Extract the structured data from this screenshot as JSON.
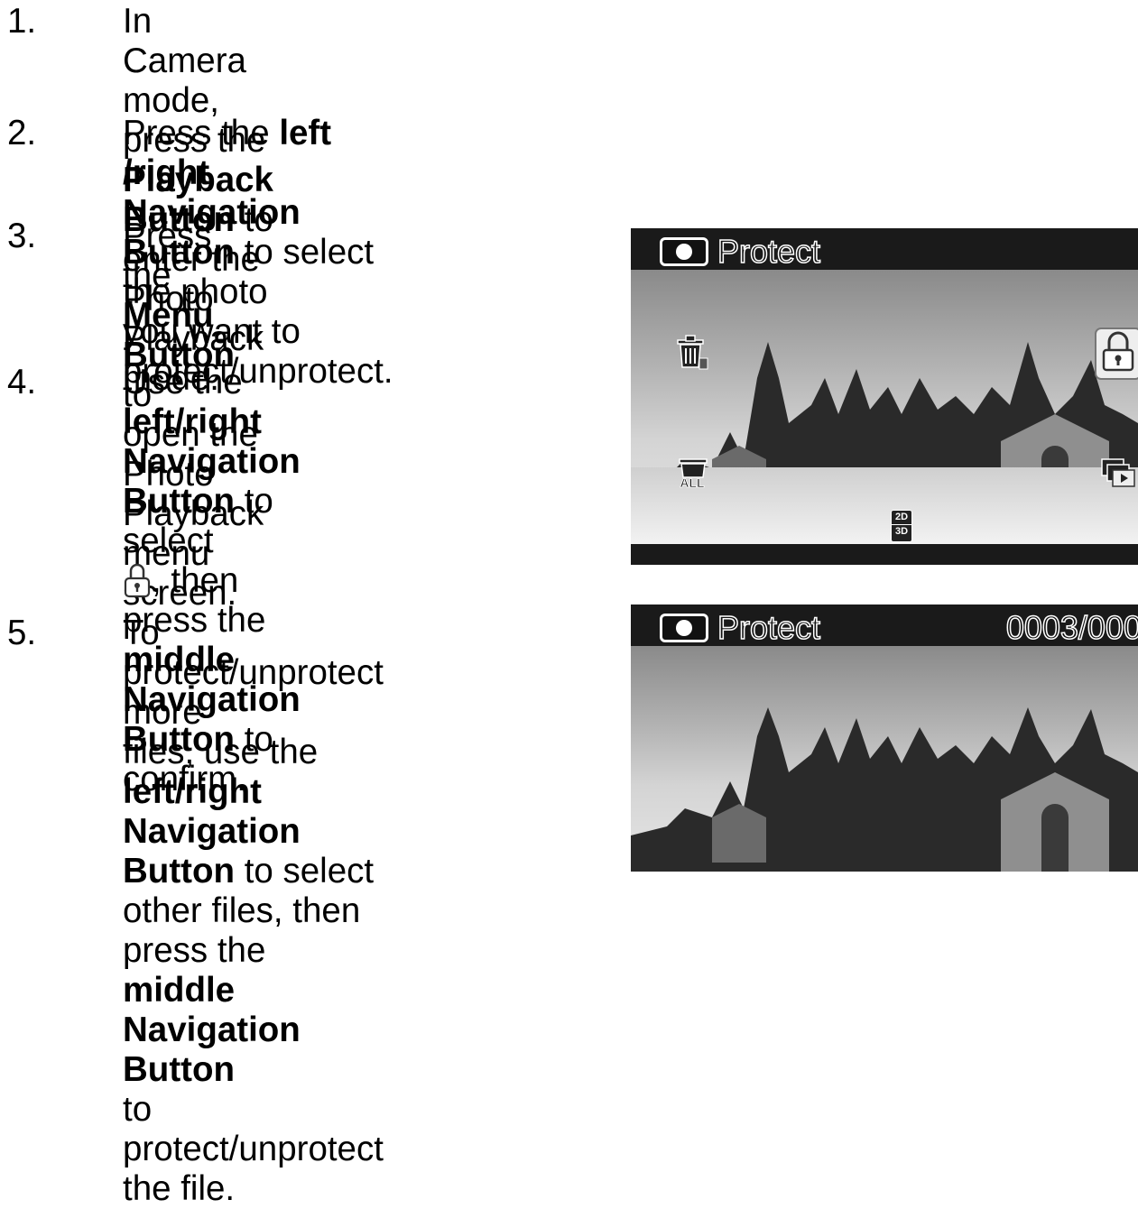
{
  "steps": [
    {
      "number": "1.",
      "lines": [
        {
          "segments": [
            {
              "text": "In Camera mode, press the ",
              "bold": false
            },
            {
              "text": "Playback Button",
              "bold": true
            },
            {
              "text": " to enter the",
              "bold": false
            }
          ]
        },
        {
          "segments": [
            {
              "text": "Photo Playback mode.",
              "bold": false
            }
          ]
        }
      ]
    },
    {
      "number": "2.",
      "lines": [
        {
          "segments": [
            {
              "text": "Press the ",
              "bold": false
            },
            {
              "text": "left /right Navigation Button",
              "bold": true
            },
            {
              "text": " to select the photo",
              "bold": false
            }
          ]
        },
        {
          "segments": [
            {
              "text": "you want to protect/unprotect.",
              "bold": false
            }
          ]
        }
      ]
    },
    {
      "number": "3.",
      "lines": [
        {
          "segments": [
            {
              "text": "Press the ",
              "bold": false
            },
            {
              "text": "Menu Button",
              "bold": true
            },
            {
              "text": " to",
              "bold": false
            }
          ]
        },
        {
          "segments": [
            {
              "text": "open the Photo Playback",
              "bold": false
            }
          ]
        },
        {
          "segments": [
            {
              "text": "menu screen.",
              "bold": false
            }
          ]
        }
      ]
    },
    {
      "number": "4.",
      "lines": [
        {
          "segments": [
            {
              "text": "Use the ",
              "bold": false
            },
            {
              "text": "left/right",
              "bold": true
            }
          ]
        },
        {
          "segments": [
            {
              "text": "Navigation Button",
              "bold": true
            },
            {
              "text": " to select",
              "bold": false
            }
          ]
        },
        {
          "segments": [
            {
              "icon": "lock-icon"
            },
            {
              "text": ", then press the ",
              "bold": false
            },
            {
              "text": "middle",
              "bold": true
            }
          ]
        },
        {
          "segments": [
            {
              "text": "Navigation Button",
              "bold": true
            },
            {
              "text": " to",
              "bold": false
            }
          ]
        },
        {
          "segments": [
            {
              "text": "confirm.",
              "bold": false
            }
          ]
        }
      ]
    },
    {
      "number": "5.",
      "lines": [
        {
          "segments": [
            {
              "text": "To protect/unprotect more",
              "bold": false
            }
          ]
        },
        {
          "segments": [
            {
              "text": "files, use the ",
              "bold": false
            },
            {
              "text": "left/right",
              "bold": true
            }
          ]
        },
        {
          "segments": [
            {
              "text": "Navigation Button",
              "bold": true
            },
            {
              "text": " to select",
              "bold": false
            }
          ]
        },
        {
          "segments": [
            {
              "text": "other files, then press the",
              "bold": false
            }
          ]
        },
        {
          "segments": [
            {
              "text": "middle Navigation Button",
              "bold": true
            }
          ]
        },
        {
          "segments": [
            {
              "text": "to protect/unprotect the file.",
              "bold": false
            }
          ]
        }
      ]
    }
  ],
  "screen1": {
    "title": "Protect",
    "icons": [
      "camera-icon",
      "delete-one-icon",
      "delete-all-icon",
      "2d-3d-icon",
      "lock-icon",
      "slideshow-icon"
    ],
    "badge_text_top": "2D",
    "badge_text_bottom": "3D",
    "delete_all_text": "ALL"
  },
  "screen2": {
    "title": "Protect",
    "counter": "0003/000",
    "icons": [
      "camera-icon"
    ]
  },
  "colors": {
    "text": "#000000",
    "screen_bg": "#1a1a1a",
    "osd_text": "#111111",
    "osd_outline": "#ffffff"
  }
}
